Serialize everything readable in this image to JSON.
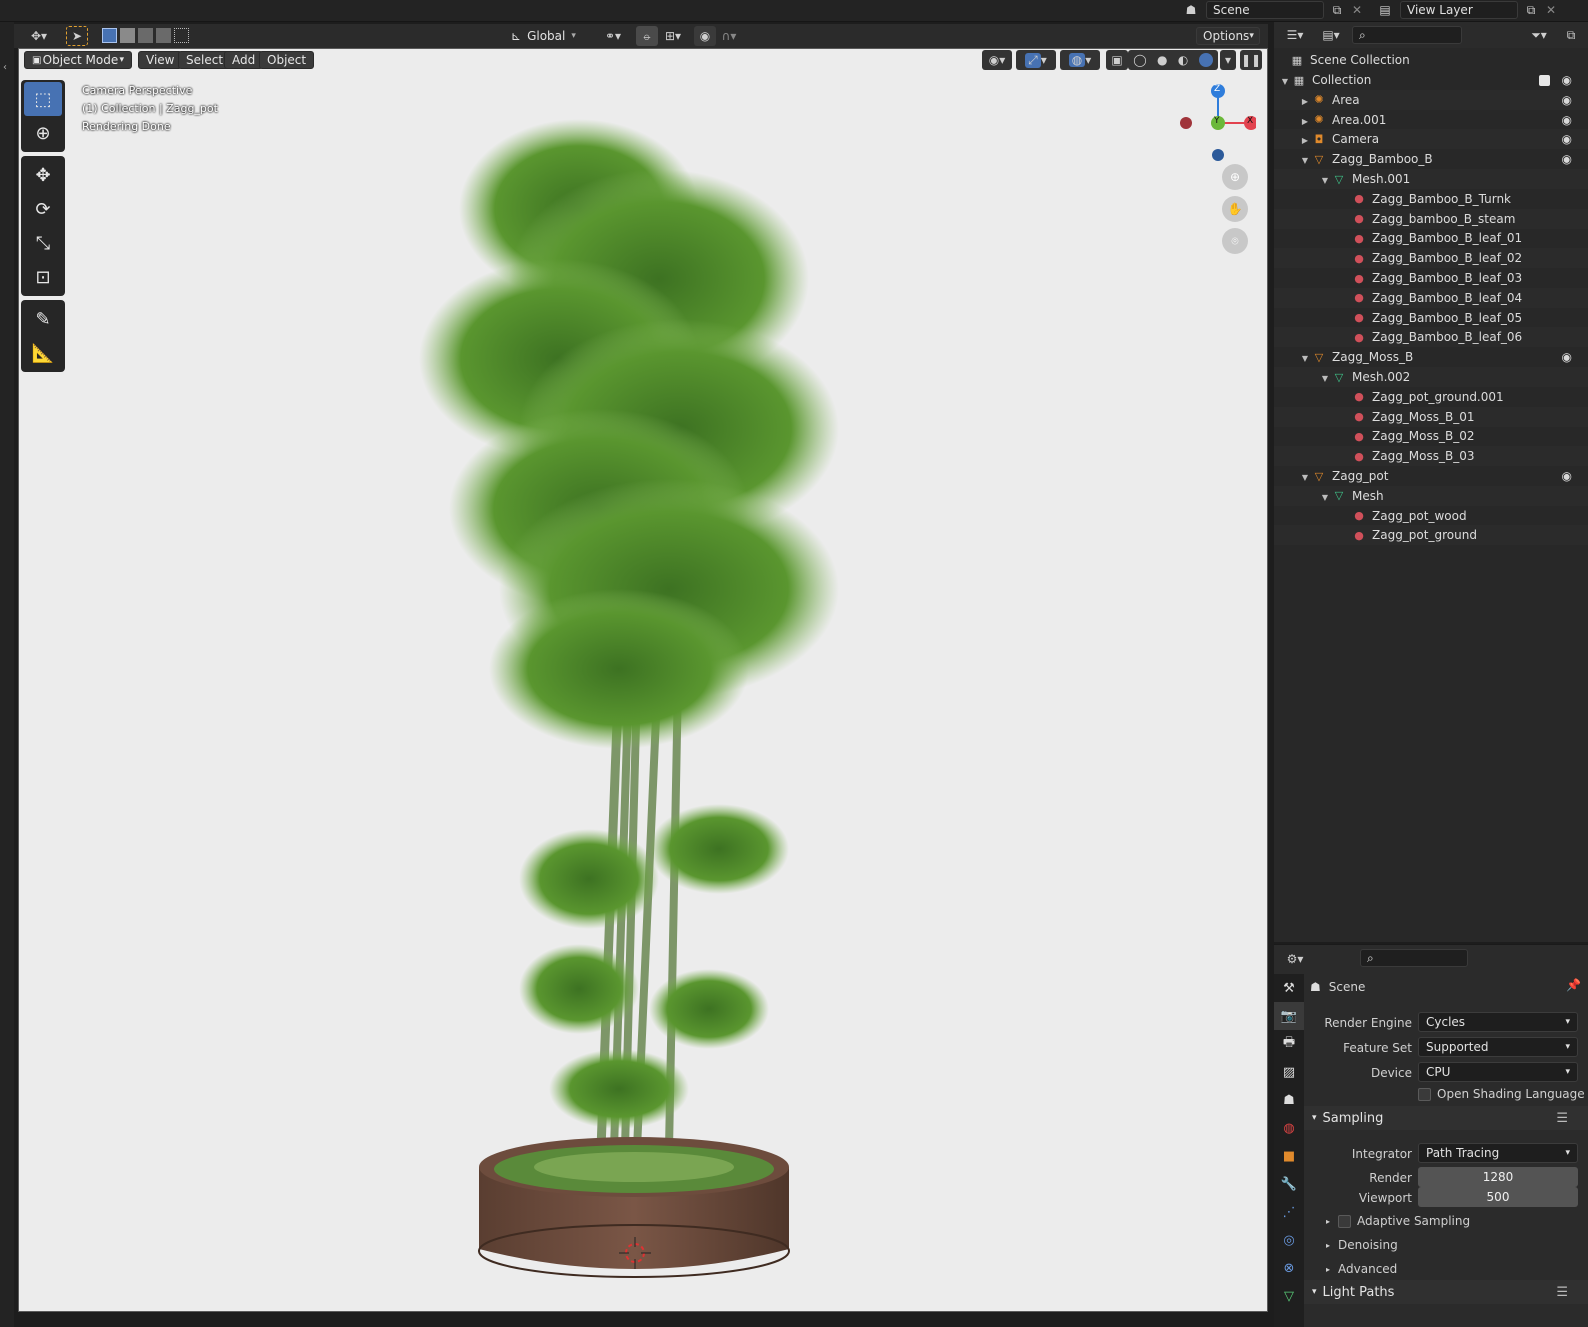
{
  "topbar": {
    "scene_label": "Scene",
    "view_layer_label": "View Layer"
  },
  "viewport_header": {
    "orientation": "Global",
    "options": "Options"
  },
  "viewport_menu": {
    "mode": "Object Mode",
    "view": "View",
    "select": "Select",
    "add": "Add",
    "object": "Object"
  },
  "viewport_overlay": {
    "line1": "Camera Perspective",
    "line2": "(1) Collection | Zagg_pot",
    "line3": "Rendering Done"
  },
  "gizmo": {
    "z": "Z",
    "y": "Y",
    "x": "X"
  },
  "outliner": {
    "root": "Scene Collection",
    "items": [
      {
        "label": "Collection",
        "level": 0,
        "icon": "collection-icon",
        "tri": "down",
        "eye": true,
        "check": true
      },
      {
        "label": "Area",
        "level": 1,
        "icon": "light-icon",
        "tri": "right",
        "eye": true
      },
      {
        "label": "Area.001",
        "level": 1,
        "icon": "light-icon",
        "tri": "right",
        "eye": true
      },
      {
        "label": "Camera",
        "level": 1,
        "icon": "camera-icon",
        "tri": "right",
        "eye": true
      },
      {
        "label": "Zagg_Bamboo_B",
        "level": 1,
        "icon": "mesh-object-icon",
        "tri": "down",
        "eye": true
      },
      {
        "label": "Mesh.001",
        "level": 2,
        "icon": "mesh-data-icon",
        "tri": "down"
      },
      {
        "label": "Zagg_Bamboo_B_Turnk",
        "level": 3,
        "icon": "material-icon"
      },
      {
        "label": "Zagg_bamboo_B_steam",
        "level": 3,
        "icon": "material-icon"
      },
      {
        "label": "Zagg_Bamboo_B_leaf_01",
        "level": 3,
        "icon": "material-icon"
      },
      {
        "label": "Zagg_Bamboo_B_leaf_02",
        "level": 3,
        "icon": "material-icon"
      },
      {
        "label": "Zagg_Bamboo_B_leaf_03",
        "level": 3,
        "icon": "material-icon"
      },
      {
        "label": "Zagg_Bamboo_B_leaf_04",
        "level": 3,
        "icon": "material-icon"
      },
      {
        "label": "Zagg_Bamboo_B_leaf_05",
        "level": 3,
        "icon": "material-icon"
      },
      {
        "label": "Zagg_Bamboo_B_leaf_06",
        "level": 3,
        "icon": "material-icon"
      },
      {
        "label": "Zagg_Moss_B",
        "level": 1,
        "icon": "mesh-object-icon",
        "tri": "down",
        "eye": true
      },
      {
        "label": "Mesh.002",
        "level": 2,
        "icon": "mesh-data-icon",
        "tri": "down"
      },
      {
        "label": "Zagg_pot_ground.001",
        "level": 3,
        "icon": "material-icon"
      },
      {
        "label": "Zagg_Moss_B_01",
        "level": 3,
        "icon": "material-icon"
      },
      {
        "label": "Zagg_Moss_B_02",
        "level": 3,
        "icon": "material-icon"
      },
      {
        "label": "Zagg_Moss_B_03",
        "level": 3,
        "icon": "material-icon"
      },
      {
        "label": "Zagg_pot",
        "level": 1,
        "icon": "mesh-object-icon",
        "tri": "down",
        "eye": true
      },
      {
        "label": "Mesh",
        "level": 2,
        "icon": "mesh-data-icon",
        "tri": "down"
      },
      {
        "label": "Zagg_pot_wood",
        "level": 3,
        "icon": "material-icon"
      },
      {
        "label": "Zagg_pot_ground",
        "level": 3,
        "icon": "material-icon"
      }
    ]
  },
  "properties": {
    "context": "Scene",
    "render_engine_label": "Render Engine",
    "render_engine_value": "Cycles",
    "feature_set_label": "Feature Set",
    "feature_set_value": "Supported",
    "device_label": "Device",
    "device_value": "CPU",
    "osl_label": "Open Shading Language",
    "sampling_title": "Sampling",
    "integrator_label": "Integrator",
    "integrator_value": "Path Tracing",
    "render_label": "Render",
    "render_value": "1280",
    "viewport_label": "Viewport",
    "viewport_value": "500",
    "adaptive_label": "Adaptive Sampling",
    "denoising_label": "Denoising",
    "advanced_label": "Advanced",
    "light_paths_title": "Light Paths"
  },
  "colors": {
    "accent": "#4772b3",
    "viewport_bg": "#ececec",
    "leaf": "#4f8a2b",
    "pot": "#6b4a3a"
  }
}
